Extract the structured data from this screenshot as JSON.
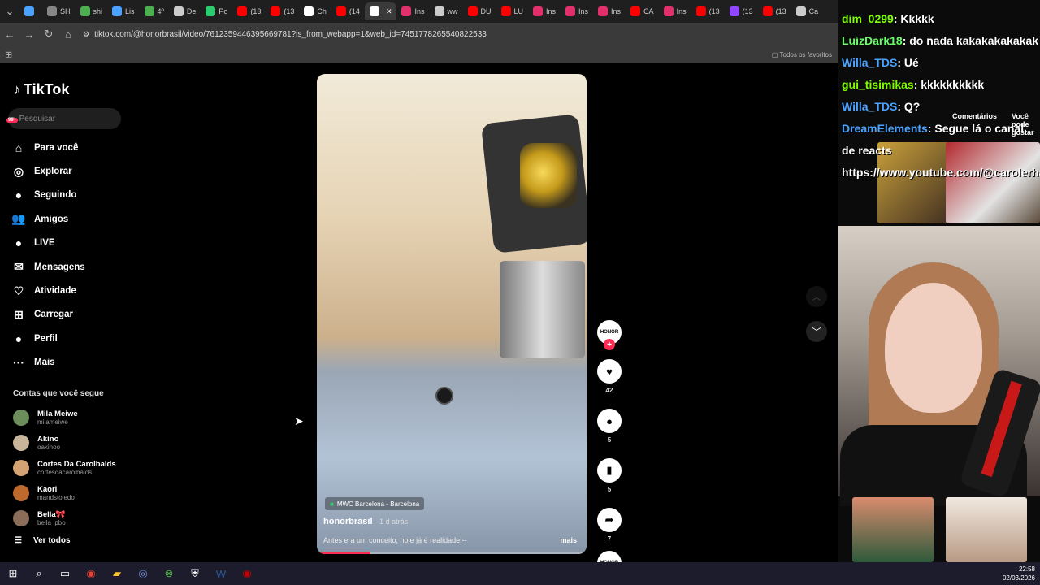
{
  "browser": {
    "tabs": [
      {
        "label": "",
        "color": "#4aa3ff"
      },
      {
        "label": "SH",
        "color": "#888888"
      },
      {
        "label": "shi",
        "color": "#4caf50"
      },
      {
        "label": "Lis",
        "color": "#4aa3ff"
      },
      {
        "label": "4º",
        "color": "#4caf50"
      },
      {
        "label": "De",
        "color": "#cccccc"
      },
      {
        "label": "Po",
        "color": "#2ecc71"
      },
      {
        "label": "(13",
        "color": "#ff0000"
      },
      {
        "label": "(13",
        "color": "#ff0000"
      },
      {
        "label": "Ch",
        "color": "#ffffff"
      },
      {
        "label": "(14",
        "color": "#ff0000"
      },
      {
        "label": "",
        "color": "#ffffff",
        "active": true
      },
      {
        "label": "Ins",
        "color": "#e1306c"
      },
      {
        "label": "ww",
        "color": "#cccccc"
      },
      {
        "label": "DU",
        "color": "#ff0000"
      },
      {
        "label": "LU",
        "color": "#ff0000"
      },
      {
        "label": "Ins",
        "color": "#e1306c"
      },
      {
        "label": "Ins",
        "color": "#e1306c"
      },
      {
        "label": "Ins",
        "color": "#e1306c"
      },
      {
        "label": "CA",
        "color": "#ff0000"
      },
      {
        "label": "Ins",
        "color": "#e1306c"
      },
      {
        "label": "(13",
        "color": "#ff0000"
      },
      {
        "label": "(13",
        "color": "#9146ff"
      },
      {
        "label": "(13",
        "color": "#ff0000"
      },
      {
        "label": "Ca",
        "color": "#cccccc"
      }
    ],
    "url": "tiktok.com/@honorbrasil/video/7612359446395669781?is_from_webapp=1&web_id=7451778265540822533",
    "bookmarks_label": "Todos os favoritos"
  },
  "tiktok": {
    "logo": "TikTok",
    "search_placeholder": "Pesquisar",
    "nav": [
      {
        "label": "Para você",
        "icon": "home-icon",
        "glyph": "⌂"
      },
      {
        "label": "Explorar",
        "icon": "compass-icon",
        "glyph": "◎"
      },
      {
        "label": "Seguindo",
        "icon": "following-avatar-icon",
        "glyph": "●"
      },
      {
        "label": "Amigos",
        "icon": "friends-icon",
        "glyph": "👥"
      },
      {
        "label": "LIVE",
        "icon": "live-icon",
        "glyph": "●"
      },
      {
        "label": "Mensagens",
        "icon": "messages-icon",
        "glyph": "✉",
        "badge": "99+"
      },
      {
        "label": "Atividade",
        "icon": "activity-icon",
        "glyph": "♡",
        "badge": "99+"
      },
      {
        "label": "Carregar",
        "icon": "upload-icon",
        "glyph": "⊞"
      },
      {
        "label": "Perfil",
        "icon": "profile-avatar-icon",
        "glyph": "●"
      },
      {
        "label": "Mais",
        "icon": "more-icon",
        "glyph": "···"
      }
    ],
    "following_title": "Contas que você segue",
    "accounts": [
      {
        "name": "Mila Meiwe",
        "handle": "milameiwe",
        "color": "#6b8e5a"
      },
      {
        "name": "Akino",
        "handle": "oakinoo",
        "color": "#c9b59a"
      },
      {
        "name": "Cortes Da Carolbalds",
        "handle": "cortesdacarolbalds",
        "color": "#d4a373"
      },
      {
        "name": "Kaori",
        "handle": "mandstoledo",
        "color": "#c0692c"
      },
      {
        "name": "Bella🎀",
        "handle": "bella_pbo",
        "color": "#8a6e5a"
      }
    ],
    "see_all": "Ver todos",
    "video": {
      "location": "MWC Barcelona - Barcelona",
      "author": "honorbrasil",
      "date": "· 1 d atrás",
      "description": "Antes era um conceito, hoje já é realidade.--",
      "more": "mais",
      "progress": 0.2
    },
    "actions": {
      "avatar_label": "HONOR",
      "likes": "42",
      "comments": "5",
      "saves": "5",
      "shares": "7"
    }
  },
  "stream": {
    "chat": [
      {
        "user": "dim_0299",
        "user_color": "#7fff00",
        "msg": ": Kkkkk"
      },
      {
        "user": "LuizDark18",
        "user_color": "#66ff66",
        "msg": ": do nada kakakakakakak"
      },
      {
        "user": "Willa_TDS",
        "user_color": "#4aa3ff",
        "msg": ": Ué"
      },
      {
        "user": "gui_tisimikas",
        "user_color": "#7fff00",
        "msg": ": kkkkkkkkkk"
      },
      {
        "user": "Willa_TDS",
        "user_color": "#4aa3ff",
        "msg": ": Q?"
      },
      {
        "user": "DreamElements",
        "user_color": "#4aa3ff",
        "msg": ": Segue lá o canal de reacts https://www.youtube.com/@carolerhay"
      }
    ],
    "tabs": [
      "Comentários",
      "Você pode gostar"
    ]
  },
  "taskbar": {
    "time": "22:58",
    "date": "02/03/2026"
  }
}
